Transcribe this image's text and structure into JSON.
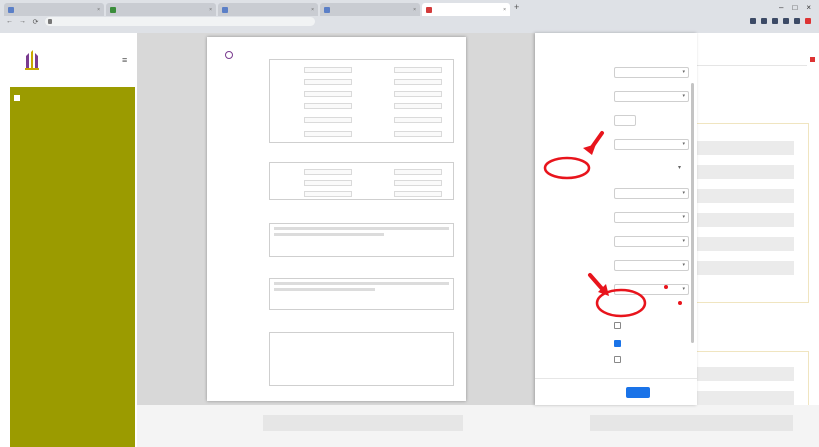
{
  "browser": {
    "tabs": [
      {
        "label": "",
        "color": "#5b7fc7"
      },
      {
        "label": "",
        "color": "#3b8d3b"
      },
      {
        "label": "",
        "color": "#5b7fc7"
      },
      {
        "label": "",
        "color": "#5b7fc7"
      },
      {
        "label": "",
        "color": "#d33b3b"
      }
    ],
    "new_tab": "+",
    "window_controls": [
      "–",
      "□",
      "×"
    ],
    "nav": [
      "←",
      "→",
      "⟳"
    ],
    "address": "",
    "bookmarks": [
      "",
      ""
    ]
  },
  "app": {
    "logo_text": "",
    "menu_item": "",
    "hamburger": "≡",
    "colors": {
      "sidebar": "#9b9b00",
      "accent": "#1a73e8",
      "annotation": "#e8141c"
    }
  },
  "preview": {
    "sections": [
      "",
      "",
      "",
      "",
      ""
    ]
  },
  "print_dialog": {
    "title": "",
    "sheets": "",
    "rows": [
      {
        "label": "",
        "value": ""
      },
      {
        "label": "",
        "value": ""
      },
      {
        "label": "",
        "value": ""
      },
      {
        "label": "",
        "value": ""
      }
    ],
    "more_settings": "",
    "rows2": [
      {
        "label": "",
        "value": ""
      },
      {
        "label": "",
        "value": ""
      },
      {
        "label": "",
        "value": ""
      },
      {
        "label": "",
        "value": ""
      },
      {
        "label": "",
        "value": ""
      }
    ],
    "scale_option": "",
    "options_label": "",
    "options": [
      {
        "label": "",
        "checked": false
      },
      {
        "label": "",
        "checked": true
      },
      {
        "label": "",
        "checked": false
      }
    ],
    "print_button": "",
    "cancel_button": ""
  },
  "form": {
    "left_label": "",
    "right_label": ""
  }
}
